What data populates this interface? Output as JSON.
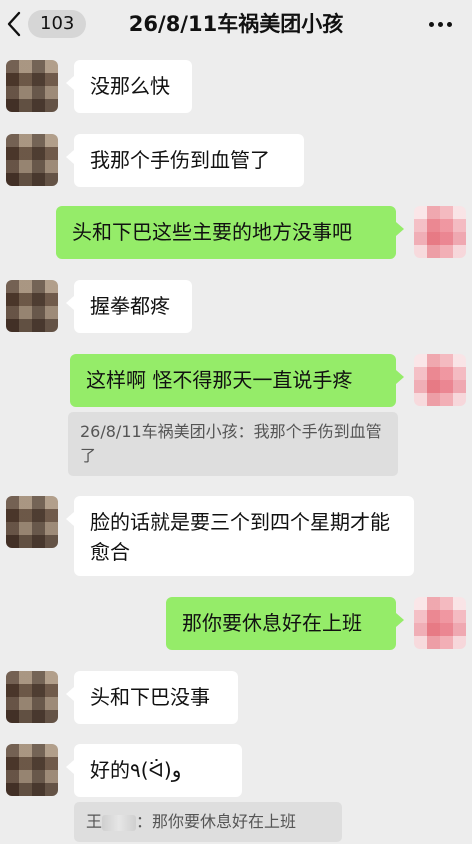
{
  "header": {
    "back_badge": "103",
    "title": "26/8/11车祸美团小孩"
  },
  "messages": [
    {
      "side": "left",
      "text": "没那么快"
    },
    {
      "side": "left",
      "text": "我那个手伤到血管了"
    },
    {
      "side": "right",
      "text": "头和下巴这些主要的地方没事吧"
    },
    {
      "side": "left",
      "text": "握拳都疼"
    },
    {
      "side": "right",
      "text": "这样啊 怪不得那天一直说手疼"
    },
    {
      "side": "quote",
      "text": "26/8/11车祸美团小孩：我那个手伤到血管了"
    },
    {
      "side": "left",
      "text": "脸的话就是要三个到四个星期才能愈合"
    },
    {
      "side": "right",
      "text": "那你要休息好在上班"
    },
    {
      "side": "left",
      "text": "头和下巴没事"
    },
    {
      "side": "left",
      "text": "好的٩(ᐛ)و"
    },
    {
      "side": "quote",
      "prefix": "王",
      "suffix": "：那你要休息好在上班"
    }
  ],
  "colors": {
    "background": "#ededed",
    "bubble_in": "#ffffff",
    "bubble_out": "#95ec69",
    "quote_bg": "#dedede"
  }
}
